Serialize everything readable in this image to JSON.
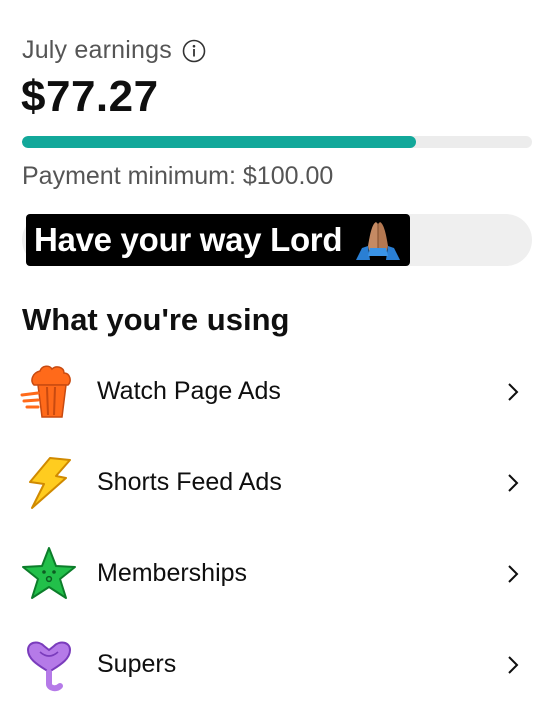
{
  "earnings": {
    "label": "July earnings",
    "amount": "$77.27",
    "progress_percent": 77.27,
    "payment_minimum": "Payment minimum: $100.00"
  },
  "message": {
    "text": "Have your way Lord",
    "emoji": "folded-hands-icon"
  },
  "section": {
    "title": "What you're using"
  },
  "features": [
    {
      "label": "Watch Page Ads",
      "icon": "popcorn-icon"
    },
    {
      "label": "Shorts Feed Ads",
      "icon": "lightning-icon"
    },
    {
      "label": "Memberships",
      "icon": "star-icon"
    },
    {
      "label": "Supers",
      "icon": "heart-icon"
    }
  ],
  "colors": {
    "progress": "#12a89a",
    "popcorn": "#ff6a1a",
    "lightning": "#ffcc1f",
    "star": "#22c04a",
    "heart": "#b57ae8"
  }
}
